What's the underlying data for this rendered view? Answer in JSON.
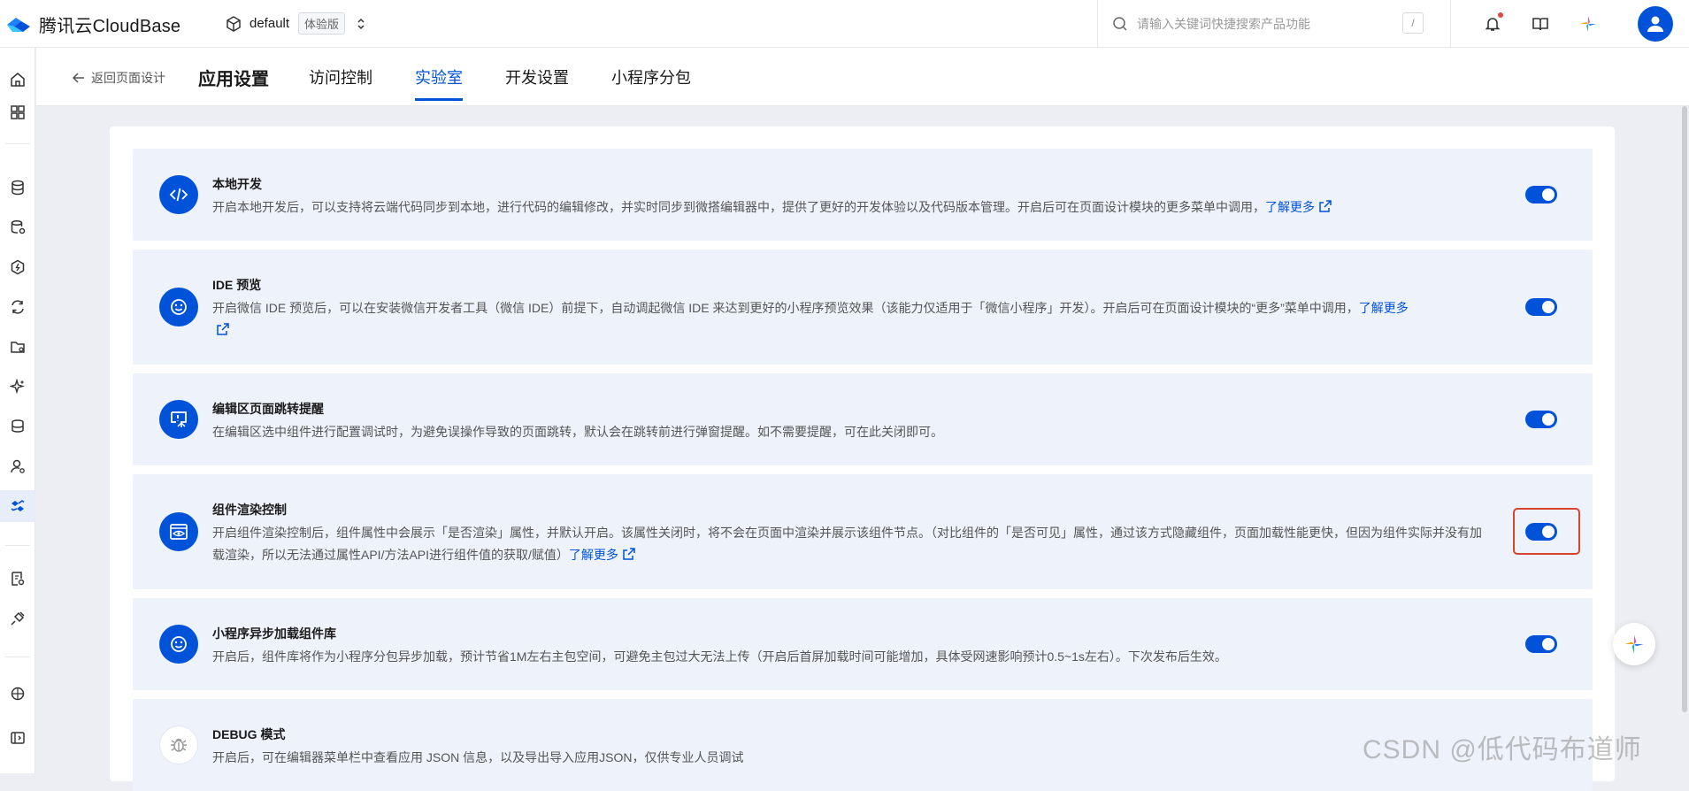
{
  "app": {
    "brand": "腾讯云CloudBase"
  },
  "env": {
    "name": "default",
    "badge": "体验版"
  },
  "search": {
    "placeholder": "请输入关键词快捷搜索产品功能",
    "shortcut": "/"
  },
  "subnav": {
    "back_label": "返回页面设计",
    "title": "应用设置",
    "tabs": [
      {
        "label": "访问控制"
      },
      {
        "label": "实验室",
        "active": true
      },
      {
        "label": "开发设置"
      },
      {
        "label": "小程序分包"
      }
    ]
  },
  "features": [
    {
      "icon": "code-icon",
      "title": "本地开发",
      "desc": "开启本地开发后，可以支持将云端代码同步到本地，进行代码的编辑修改，并实时同步到微搭编辑器中，提供了更好的开发体验以及代码版本管理。开启后可在页面设计模块的更多菜单中调用，",
      "link": "了解更多",
      "enabled": true
    },
    {
      "icon": "smile-icon",
      "title": "IDE 预览",
      "desc": "开启微信 IDE 预览后，可以在安装微信开发者工具（微信 IDE）前提下，自动调起微信 IDE 来达到更好的小程序预览效果（该能力仅适用于「微信小程序」开发）。开启后可在页面设计模块的“更多”菜单中调用，",
      "link": "了解更多",
      "enabled": true
    },
    {
      "icon": "redirect-alert-icon",
      "title": "编辑区页面跳转提醒",
      "desc": "在编辑区选中组件进行配置调试时，为避免误操作导致的页面跳转，默认会在跳转前进行弹窗提醒。如不需要提醒，可在此关闭即可。",
      "link": "",
      "enabled": true
    },
    {
      "icon": "render-eye-icon",
      "title": "组件渲染控制",
      "desc": "开启组件渲染控制后，组件属性中会展示「是否渲染」属性，并默认开启。该属性关闭时，将不会在页面中渲染并展示该组件节点。（对比组件的「是否可见」属性，通过该方式隐藏组件，页面加载性能更快，但因为组件实际并没有加载渲染，所以无法通过属性API/方法API进行组件值的获取/赋值）",
      "link": "了解更多",
      "enabled": true,
      "highlighted": true
    },
    {
      "icon": "smile-icon",
      "title": "小程序异步加载组件库",
      "desc": "开启后，组件库将作为小程序分包异步加载，预计节省1M左右主包空间，可避免主包过大无法上传（开启后首屏加载时间可能增加，具体受网速影响预计0.5~1s左右）。下次发布后生效。",
      "link": "",
      "enabled": true
    },
    {
      "icon": "bug-icon",
      "title": "DEBUG 模式",
      "desc": "开启后，可在编辑器菜单栏中查看应用 JSON 信息，以及导出导入应用JSON，仅供专业人员调试",
      "link": "",
      "enabled": true
    }
  ],
  "watermark": "CSDN @低代码布道师",
  "colors": {
    "primary": "#0052d9",
    "card_bg": "#edf2fb",
    "highlight": "#d8452f"
  }
}
